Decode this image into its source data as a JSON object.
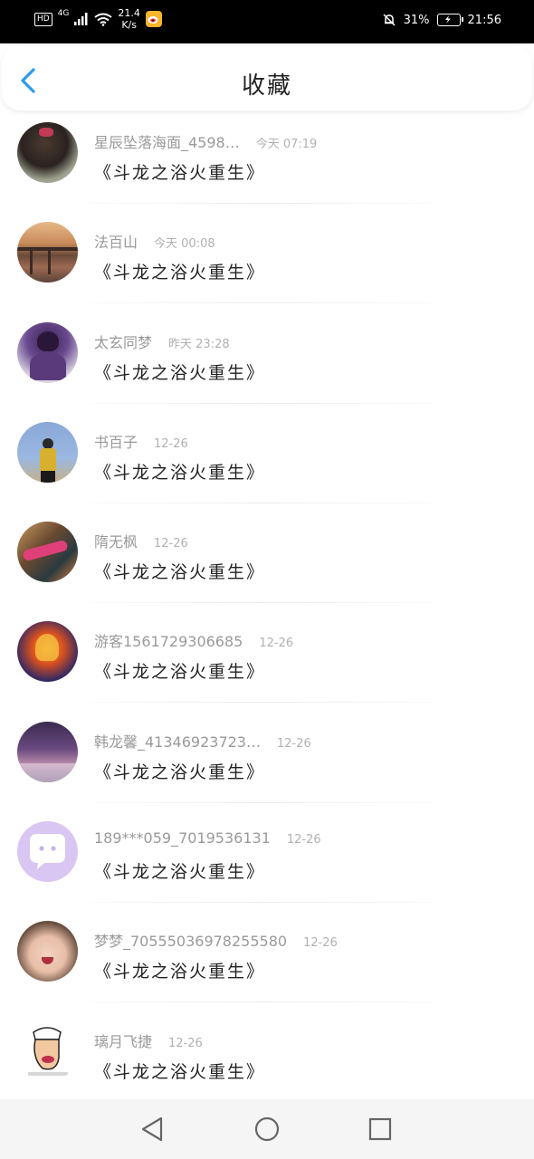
{
  "status_bar": {
    "hd": "HD",
    "network": "4G",
    "speed_value": "21.4",
    "speed_unit": "K/s",
    "battery": "31%",
    "time": "21:56"
  },
  "header": {
    "title": "收藏",
    "back_icon": "chevron-left-icon",
    "accent": "#2a9bf0"
  },
  "favorites": [
    {
      "name": "星辰坠落海面_4598…",
      "time": "今天 07:19",
      "content": "《斗龙之浴火重生》"
    },
    {
      "name": "法百山",
      "time": "今天 00:08",
      "content": "《斗龙之浴火重生》"
    },
    {
      "name": "太玄同梦",
      "time": "昨天 23:28",
      "content": "《斗龙之浴火重生》"
    },
    {
      "name": "书百子",
      "time": "12-26",
      "content": "《斗龙之浴火重生》"
    },
    {
      "name": "隋无枫",
      "time": "12-26",
      "content": "《斗龙之浴火重生》"
    },
    {
      "name": "游客1561729306685",
      "time": "12-26",
      "content": "《斗龙之浴火重生》"
    },
    {
      "name": "韩龙馨_41346923723…",
      "time": "12-26",
      "content": "《斗龙之浴火重生》"
    },
    {
      "name": "189***059_7019536131",
      "time": "12-26",
      "content": "《斗龙之浴火重生》"
    },
    {
      "name": "梦梦_70555036978255580",
      "time": "12-26",
      "content": "《斗龙之浴火重生》"
    },
    {
      "name": "璃月飞捷",
      "time": "12-26",
      "content": "《斗龙之浴火重生》"
    }
  ],
  "nav_bar": {
    "back": "triangle-back-icon",
    "home": "circle-home-icon",
    "recent": "square-recent-icon"
  }
}
